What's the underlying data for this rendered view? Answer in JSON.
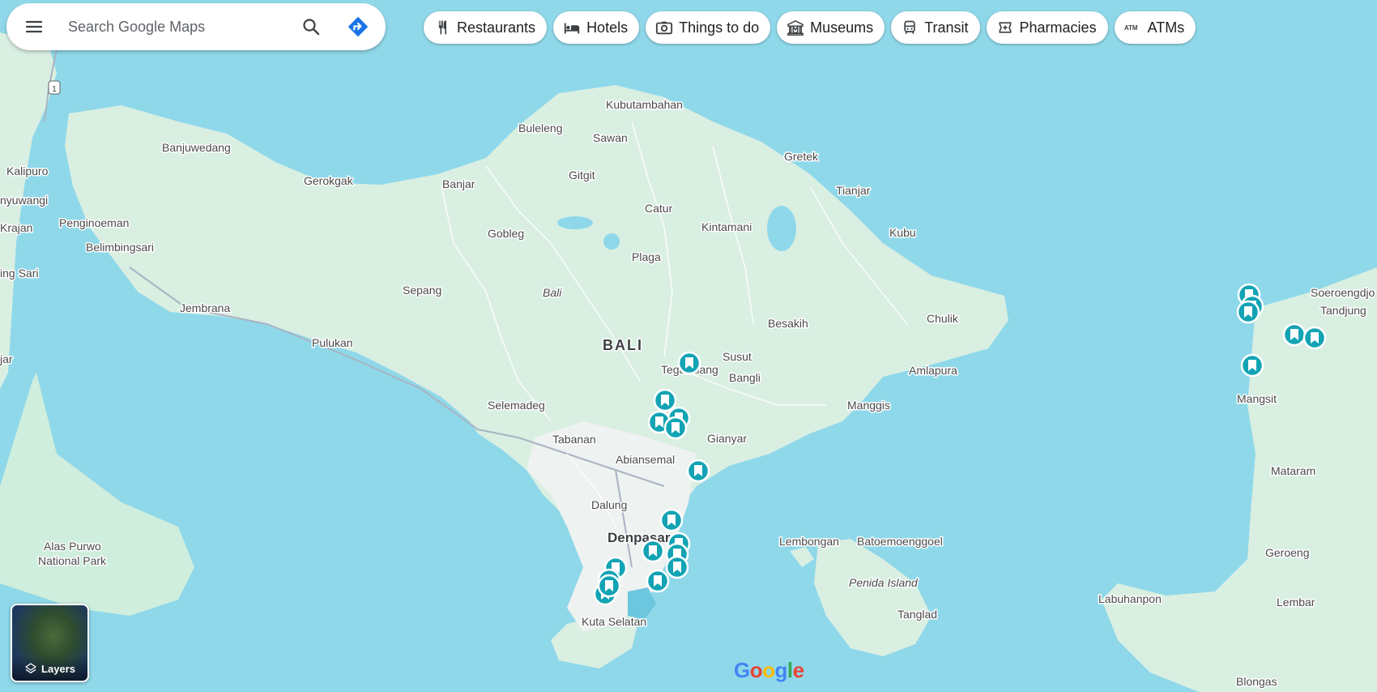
{
  "search": {
    "placeholder": "Search Google Maps"
  },
  "chips": [
    {
      "label": "Restaurants",
      "icon": "restaurant-icon"
    },
    {
      "label": "Hotels",
      "icon": "hotel-icon"
    },
    {
      "label": "Things to do",
      "icon": "camera-icon"
    },
    {
      "label": "Museums",
      "icon": "museum-icon"
    },
    {
      "label": "Transit",
      "icon": "train-icon"
    },
    {
      "label": "Pharmacies",
      "icon": "pharmacy-icon"
    },
    {
      "label": "ATMs",
      "icon": "atm-icon"
    }
  ],
  "places": {
    "bali": "BALI",
    "denpasar": "Denpasar",
    "kubutambahan": "Kubutambahan",
    "buleleng": "Buleleng",
    "sawan": "Sawan",
    "gretek": "Gretek",
    "tianjar": "Tianjar",
    "kubu": "Kubu",
    "banjuwedang": "Banjuwedang",
    "gerokgak": "Gerokgak",
    "banjar": "Banjar",
    "gitgit": "Gitgit",
    "catur": "Catur",
    "gobleg": "Gobleg",
    "kintamani": "Kintamani",
    "plaga": "Plaga",
    "sepang": "Sepang",
    "bali_region": "Bali",
    "jembrana": "Jembrana",
    "pulukan": "Pulukan",
    "penginoeman": "Penginoeman",
    "belimbingsari": "Belimbingsari",
    "kalipuro": "Kalipuro",
    "nyuwangi": "nyuwangi",
    "krajan": "Krajan",
    "ing_sari": "ing Sari",
    "jar": "jar",
    "besakih": "Besakih",
    "chulik": "Chulik",
    "amlapura": "Amlapura",
    "susut": "Susut",
    "bangli": "Bangli",
    "tegallalang": "Tegallalang",
    "manggis": "Manggis",
    "selemadeg": "Selemadeg",
    "tabanan": "Tabanan",
    "abiansemal": "Abiansemal",
    "gianyar": "Gianyar",
    "dalung": "Dalung",
    "kuta_selatan": "Kuta Selatan",
    "lembongan": "Lembongan",
    "batoemoenggoel": "Batoemoenggoel",
    "penida": "Penida Island",
    "tanglad": "Tanglad",
    "alas_purwo": "Alas Purwo",
    "national_park": "National Park",
    "soeroengdjo": "Soeroengdjo",
    "tandjung": "Tandjung",
    "mangsit": "Mangsit",
    "mataram": "Mataram",
    "geroeng": "Geroeng",
    "labuhanpon": "Labuhanpon",
    "lembar": "Lembar",
    "blongas": "Blongas",
    "road_1": "1"
  },
  "layers": {
    "label": "Layers"
  },
  "logo": {
    "text": "Google"
  },
  "colors": {
    "water": "#8fd8ea",
    "land": "#d9efe2",
    "urban": "#eef2f0",
    "pin": "#12a3b4",
    "accent": "#1a73e8"
  }
}
